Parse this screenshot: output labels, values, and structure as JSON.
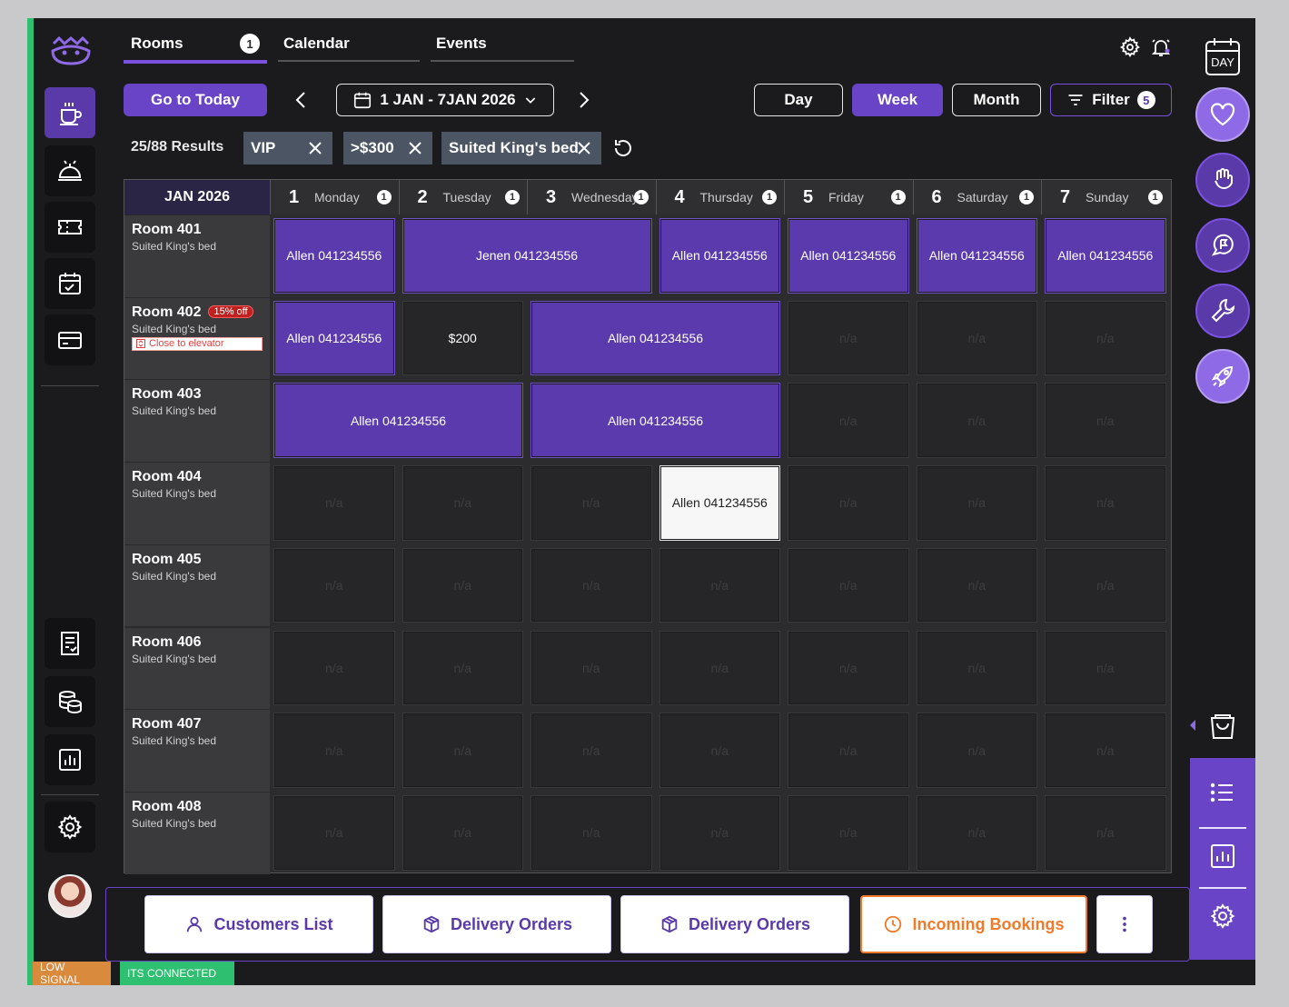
{
  "tabs": [
    {
      "label": "Rooms",
      "badge": "1",
      "active": true
    },
    {
      "label": "Calendar",
      "active": false
    },
    {
      "label": "Events",
      "active": false
    }
  ],
  "toolbar": {
    "go_today": "Go to Today",
    "date_range": "1 JAN - 7JAN 2026",
    "views": [
      "Day",
      "Week",
      "Month"
    ],
    "active_view": "Week",
    "filter_label": "Filter",
    "filter_count": "5"
  },
  "results": "25/88 Results",
  "chips": [
    "VIP",
    ">$300",
    "Suited King's bed"
  ],
  "grid": {
    "month": "JAN 2026",
    "days": [
      {
        "num": "1",
        "name": "Monday",
        "info": "1"
      },
      {
        "num": "2",
        "name": "Tuesday",
        "info": "1"
      },
      {
        "num": "3",
        "name": "Wednesday",
        "info": "1"
      },
      {
        "num": "4",
        "name": "Thursday",
        "info": "1"
      },
      {
        "num": "5",
        "name": "Friday",
        "info": "1"
      },
      {
        "num": "6",
        "name": "Saturday",
        "info": "1"
      },
      {
        "num": "7",
        "name": "Sunday",
        "info": "1"
      }
    ],
    "rooms": [
      {
        "name": "Room 401",
        "type": "Suited King's bed"
      },
      {
        "name": "Room 402",
        "type": "Suited King's bed",
        "discount": "15% off",
        "note": "Close to elevator"
      },
      {
        "name": "Room 403",
        "type": "Suited King's bed"
      },
      {
        "name": "Room 404",
        "type": "Suited King's bed"
      },
      {
        "name": "Room 405",
        "type": "Suited King's bed"
      },
      {
        "name": "Room 406",
        "type": "Suited King's bed"
      },
      {
        "name": "Room 407",
        "type": "Suited King's bed"
      },
      {
        "name": "Room 408",
        "type": "Suited King's bed"
      }
    ],
    "empty_label": "n/a",
    "bookings": [
      {
        "row": 0,
        "start": 0,
        "span": 1,
        "label": "Allen 041234556",
        "kind": "booked"
      },
      {
        "row": 0,
        "start": 1,
        "span": 2,
        "label": "Jenen 041234556",
        "kind": "booked"
      },
      {
        "row": 0,
        "start": 3,
        "span": 1,
        "label": "Allen 041234556",
        "kind": "booked"
      },
      {
        "row": 0,
        "start": 4,
        "span": 1,
        "label": "Allen 041234556",
        "kind": "booked"
      },
      {
        "row": 0,
        "start": 5,
        "span": 1,
        "label": "Allen 041234556",
        "kind": "booked"
      },
      {
        "row": 0,
        "start": 6,
        "span": 1,
        "label": "Allen 041234556",
        "kind": "booked"
      },
      {
        "row": 1,
        "start": 0,
        "span": 1,
        "label": "Allen 041234556",
        "kind": "booked"
      },
      {
        "row": 1,
        "start": 1,
        "span": 1,
        "label": "$200",
        "kind": "price"
      },
      {
        "row": 1,
        "start": 2,
        "span": 2,
        "label": "Allen 041234556",
        "kind": "booked"
      },
      {
        "row": 2,
        "start": 0,
        "span": 2,
        "label": "Allen 041234556",
        "kind": "booked"
      },
      {
        "row": 2,
        "start": 2,
        "span": 2,
        "label": "Allen 041234556",
        "kind": "booked"
      },
      {
        "row": 3,
        "start": 3,
        "span": 1,
        "label": "Allen 041234556",
        "kind": "white"
      }
    ]
  },
  "bottom_buttons": [
    "Customers List",
    "Delivery Orders",
    "Delivery Orders",
    "Incoming Bookings"
  ],
  "status": {
    "low_signal": "LOW SIGNAL",
    "connected": "ITS CONNECTED"
  },
  "right": {
    "day_label": "DAY"
  },
  "colors": {
    "accent": "#6a44c7",
    "orange": "#f07a2a",
    "green": "#2fbf71"
  }
}
